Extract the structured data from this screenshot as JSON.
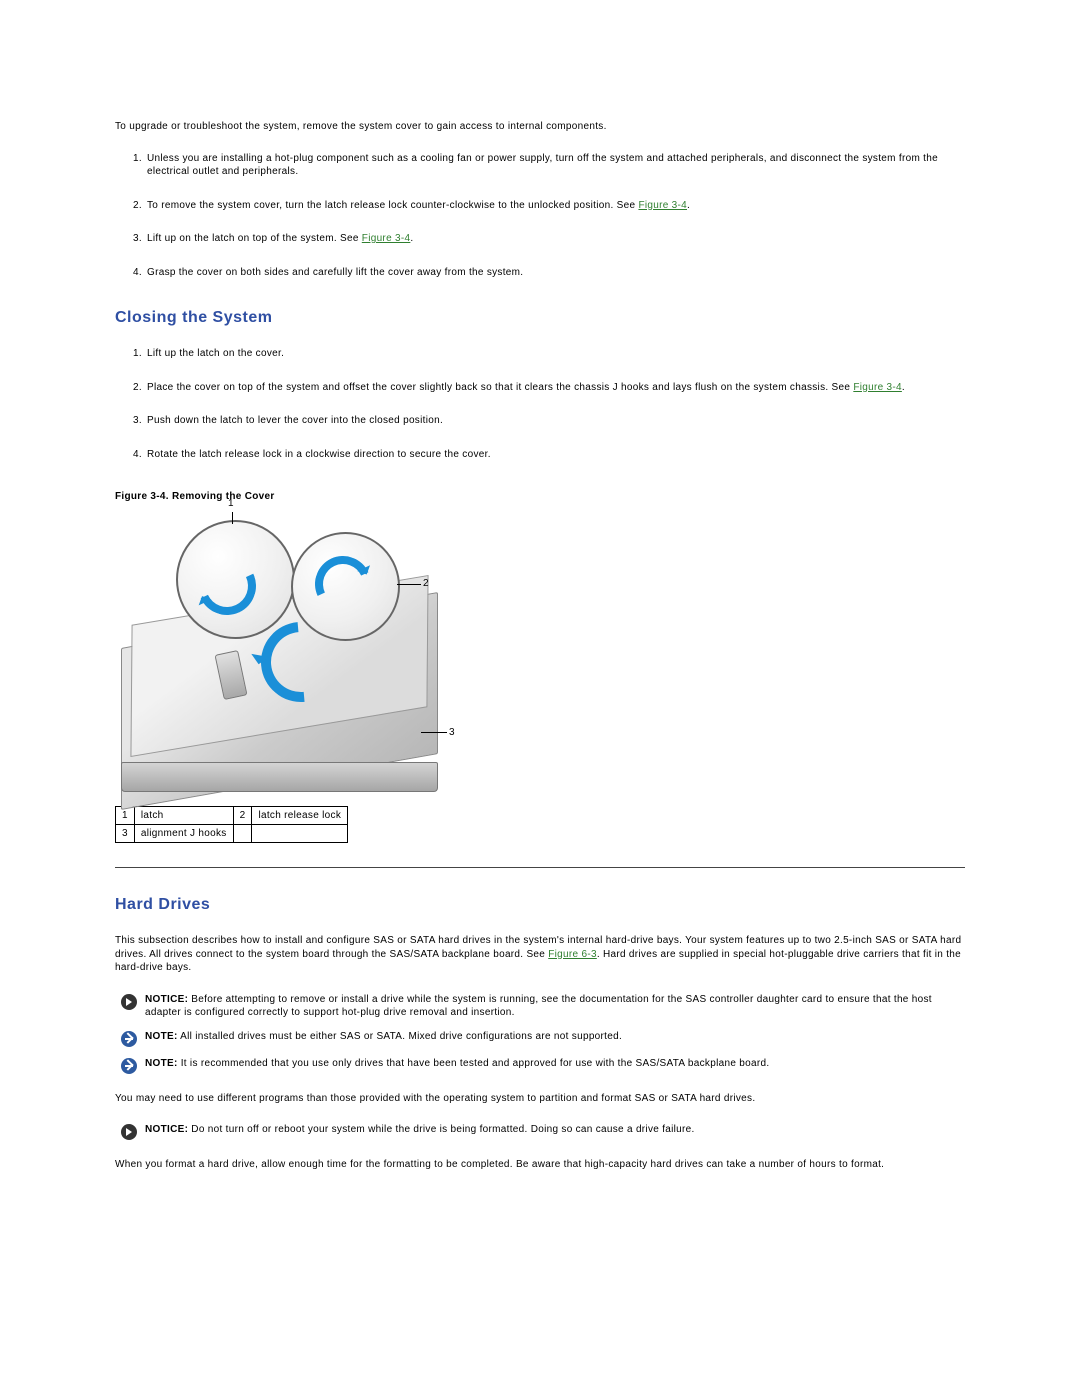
{
  "intro": "To upgrade or troubleshoot the system, remove the system cover to gain access to internal components.",
  "open_steps": {
    "s1": "Unless you are installing a hot-plug component such as a cooling fan or power supply, turn off the system and attached peripherals, and disconnect the system from the electrical outlet and peripherals.",
    "s2a": "To remove the system cover, turn the latch release lock counter-clockwise to the unlocked position. See ",
    "s2_link": "Figure 3-4",
    "s2b": ".",
    "s3a": "Lift up on the latch on top of the system. See ",
    "s3_link": "Figure 3-4",
    "s3b": ".",
    "s4": "Grasp the cover on both sides and carefully lift the cover away from the system."
  },
  "closing_heading": "Closing the System",
  "close_steps": {
    "s1": "Lift up the latch on the cover.",
    "s2a": "Place the cover on top of the system and offset the cover slightly back so that it clears the chassis J hooks and lays flush on the system chassis. See ",
    "s2_link": "Figure 3-4",
    "s2b": ".",
    "s3": "Push down the latch to lever the cover into the closed position.",
    "s4": "Rotate the latch release lock in a clockwise direction to secure the cover."
  },
  "figure_caption": "Figure 3-4. Removing the Cover",
  "fig_callouts": {
    "c1": "1",
    "c2": "2",
    "c3": "3"
  },
  "parts_table": {
    "r1c1": "1",
    "r1c2": "latch",
    "r1c3": "2",
    "r1c4": "latch release lock",
    "r2c1": "3",
    "r2c2": "alignment J hooks",
    "r2c3": "",
    "r2c4": ""
  },
  "hd_heading": "Hard Drives",
  "hd_intro_a": "This subsection describes how to install and configure SAS or SATA hard drives in the system's internal hard-drive bays. Your system features up to two 2.5-inch SAS or SATA hard drives. All drives connect to the system board through the SAS/SATA backplane board. See ",
  "hd_intro_link": "Figure 6-3",
  "hd_intro_b": ". Hard drives are supplied in special hot-pluggable drive carriers that fit in the hard-drive bays.",
  "notice1_label": "NOTICE:",
  "notice1_text": " Before attempting to remove or install a drive while the system is running, see the documentation for the SAS controller daughter card to ensure that the host adapter is configured correctly to support hot-plug drive removal and insertion.",
  "note1_label": "NOTE:",
  "note1_text": " All installed drives must be either SAS or SATA. Mixed drive configurations are not supported.",
  "note2_label": "NOTE:",
  "note2_text": " It is recommended that you use only drives that have been tested and approved for use with the SAS/SATA backplane board.",
  "hd_mid": "You may need to use different programs than those provided with the operating system to partition and format SAS or SATA hard drives.",
  "notice2_label": "NOTICE:",
  "notice2_text": " Do not turn off or reboot your system while the drive is being formatted. Doing so can cause a drive failure.",
  "hd_end": "When you format a hard drive, allow enough time for the formatting to be completed. Be aware that high-capacity hard drives can take a number of hours to format."
}
